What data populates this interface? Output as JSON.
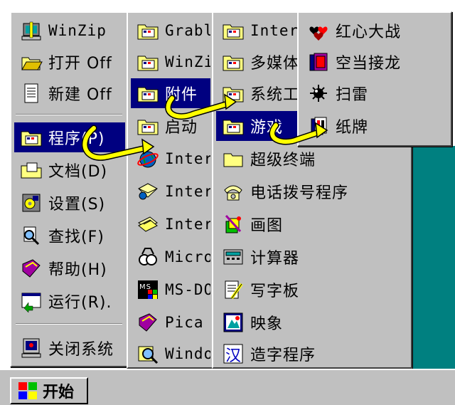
{
  "start_menu": {
    "items": [
      {
        "label": "WinZip",
        "icon": "winzip-icon"
      },
      {
        "label": "打开 Off",
        "icon": "open-folder-icon"
      },
      {
        "label": "新建 Off",
        "icon": "new-document-icon"
      },
      {
        "label": "程序(P)",
        "icon": "programs-folder-icon"
      },
      {
        "label": "文档(D)",
        "icon": "documents-icon"
      },
      {
        "label": "设置(S)",
        "icon": "settings-icon"
      },
      {
        "label": "查找(F)",
        "icon": "find-icon"
      },
      {
        "label": "帮助(H)",
        "icon": "help-book-icon"
      },
      {
        "label": "运行(R).",
        "icon": "run-icon"
      },
      {
        "label": "关闭系统",
        "icon": "shutdown-icon"
      }
    ]
  },
  "programs_menu": {
    "items": [
      {
        "label": "Grabl",
        "icon": "folder-icon"
      },
      {
        "label": "WinZi",
        "icon": "folder-icon"
      },
      {
        "label": "附件",
        "icon": "folder-icon"
      },
      {
        "label": "启动",
        "icon": "folder-icon"
      },
      {
        "label": "Inter",
        "icon": "internet-explorer-icon"
      },
      {
        "label": "Inter",
        "icon": "internet-mail-icon"
      },
      {
        "label": "Inter",
        "icon": "internet-news-icon"
      },
      {
        "label": "Micro",
        "icon": "microsoft-icon"
      },
      {
        "label": "MS-DO",
        "icon": "ms-dos-icon"
      },
      {
        "label": "Pica",
        "icon": "book-icon"
      },
      {
        "label": "Windo",
        "icon": "explorer-icon"
      }
    ]
  },
  "accessories_menu": {
    "items": [
      {
        "label": "Inter",
        "icon": "folder-icon"
      },
      {
        "label": "多媒体",
        "icon": "folder-icon"
      },
      {
        "label": "系统工",
        "icon": "folder-icon"
      },
      {
        "label": "游戏",
        "icon": "folder-icon"
      },
      {
        "label": "超级终端",
        "icon": "folder-plain-icon"
      },
      {
        "label": "电话拨号程序",
        "icon": "phone-dialer-icon"
      },
      {
        "label": "画图",
        "icon": "paint-icon"
      },
      {
        "label": "计算器",
        "icon": "calculator-icon"
      },
      {
        "label": "写字板",
        "icon": "wordpad-icon"
      },
      {
        "label": "映象",
        "icon": "imaging-icon"
      },
      {
        "label": "造字程序",
        "icon": "char-editor-icon"
      }
    ]
  },
  "games_menu": {
    "items": [
      {
        "label": "红心大战",
        "icon": "hearts-icon"
      },
      {
        "label": "空当接龙",
        "icon": "freecell-icon"
      },
      {
        "label": "扫雷",
        "icon": "minesweeper-icon"
      },
      {
        "label": "纸牌",
        "icon": "solitaire-icon"
      }
    ]
  },
  "taskbar": {
    "start_label": "开始"
  }
}
